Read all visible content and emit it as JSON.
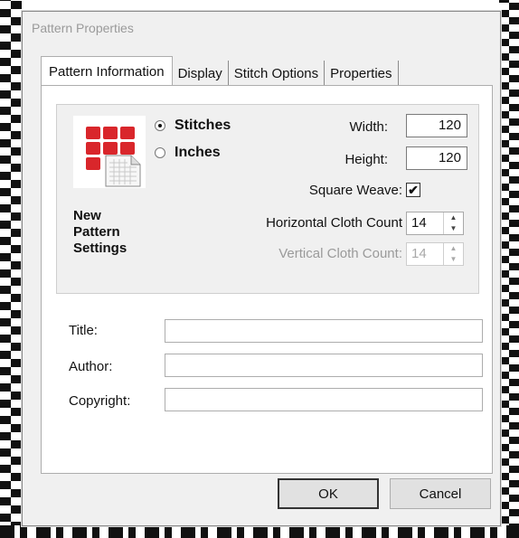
{
  "window": {
    "title": "Pattern Properties"
  },
  "tabs": [
    {
      "label": "Pattern Information",
      "active": true
    },
    {
      "label": "Display",
      "active": false
    },
    {
      "label": "Stitch Options",
      "active": false
    },
    {
      "label": "Properties",
      "active": false
    }
  ],
  "settings": {
    "heading_line1": "New",
    "heading_line2": "Pattern",
    "heading_line3": "Settings",
    "icon": "pattern-grid-icon",
    "units": {
      "stitches_label": "Stitches",
      "inches_label": "Inches",
      "selected": "Stitches"
    },
    "width_label": "Width:",
    "width_value": "120",
    "height_label": "Height:",
    "height_value": "120",
    "square_weave_label": "Square Weave:",
    "square_weave_checked": true,
    "horizontal_label": "Horizontal Cloth Count",
    "horizontal_value": "14",
    "vertical_label": "Vertical Cloth Count:",
    "vertical_value": "14"
  },
  "fields": {
    "title_label": "Title:",
    "title_value": "",
    "author_label": "Author:",
    "author_value": "",
    "copyright_label": "Copyright:",
    "copyright_value": ""
  },
  "buttons": {
    "ok_label": "OK",
    "cancel_label": "Cancel"
  },
  "colors": {
    "icon_red": "#d9262b",
    "dialog_bg": "#f0f0f0"
  }
}
